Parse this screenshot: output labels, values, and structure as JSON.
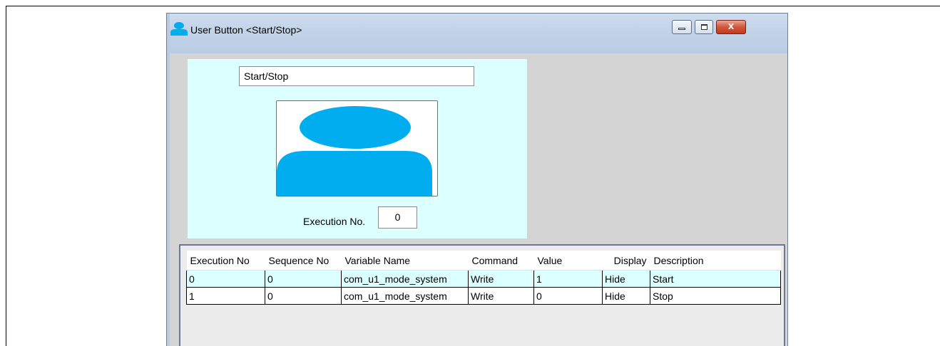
{
  "window": {
    "title": "User Button <Start/Stop>",
    "controls": {
      "minimize_icon": "minimize-icon",
      "maximize_icon": "maximize-icon",
      "close_glyph": "x"
    }
  },
  "preview": {
    "name_value": "Start/Stop",
    "image_icon": "user-icon",
    "execution_label": "Execution No.",
    "execution_value": "0",
    "icon_color": "#00aeef"
  },
  "table": {
    "headers": [
      "Execution No",
      "Sequence No",
      "Variable Name",
      "Command",
      "Value",
      "Display",
      "Description"
    ],
    "rows": [
      [
        "0",
        "0",
        "com_u1_mode_system",
        "Write",
        "1",
        "Hide",
        "Start"
      ],
      [
        "1",
        "0",
        "com_u1_mode_system",
        "Write",
        "0",
        "Hide",
        "Stop"
      ]
    ]
  }
}
